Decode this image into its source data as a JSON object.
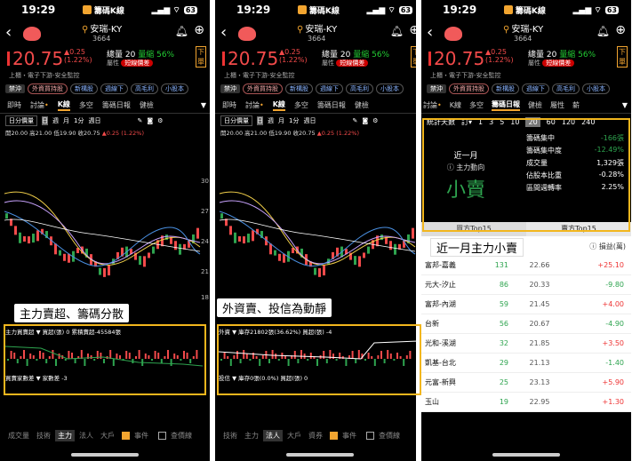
{
  "status": {
    "time1": "19:29",
    "time2": "19:29",
    "time3": "19:29",
    "app": "籌碼K線",
    "battery": "63"
  },
  "stock": {
    "name": "安瑞-KY",
    "code": "3664",
    "price": "20.75",
    "change": "▲0.25",
    "pct": "(1.22%)",
    "vol_label": "總量",
    "vol": "20",
    "amount_label": "量縮",
    "amount_pct": "56%",
    "attr_label": "屬性",
    "attr_badge": "短線價差",
    "trade": "下單",
    "industry": "上櫃・電子下游-安全監控"
  },
  "tags": [
    "禁沖",
    "外資買持股",
    "新構股",
    "週線下",
    "高毛利",
    "小股本"
  ],
  "tabs": [
    "即時",
    "討論",
    "K線",
    "多空",
    "籌碼日報",
    "健檢"
  ],
  "ctl": [
    "日分價量",
    "日",
    "週",
    "月",
    "1分",
    "週日"
  ],
  "ohlc": {
    "text": "開20.00 高21.00 低19.90 收20.75",
    "chg": "▲0.25 (1.22%)"
  },
  "axis": [
    "30",
    "27",
    "24",
    "21",
    "18"
  ],
  "captions": {
    "p1": "主力賣超、籌碼分散",
    "p2": "外資賣、投信為動靜"
  },
  "sub1": {
    "a": "主力買賣超 ▼ 買超(張) 0 累積賣超-45584張",
    "b": "買賣家數差 ▼ 家數差 -3"
  },
  "sub2": {
    "a": "外資 ▼ 庫存21802張(36.62%) 買超(張) -4",
    "b": "投信 ▼ 庫存0張(0.0%) 買超(張) 0"
  },
  "bottom1": [
    "成交量",
    "技術",
    "主力",
    "法人",
    "大戶"
  ],
  "bottom2": [
    "技術",
    "主力",
    "法人",
    "大戶",
    "資券"
  ],
  "bottom_chk": [
    "事件",
    "查價線"
  ],
  "p3": {
    "tabs": [
      "討論",
      "K線",
      "多空",
      "籌碼日報",
      "健檢",
      "屬性",
      "薪"
    ],
    "days_label": "統計天數",
    "days_opt": "訂",
    "days": [
      "1",
      "3",
      "5",
      "10",
      "20",
      "60",
      "120",
      "240"
    ],
    "period": "近一月",
    "flow": "主力動向",
    "verdict": "小賣",
    "metrics": [
      {
        "k": "籌碼集中",
        "v": "-166張"
      },
      {
        "k": "籌碼集中度",
        "v": "-12.49%"
      },
      {
        "k": "成交量",
        "v": "1,329張"
      },
      {
        "k": "佔股本比重",
        "v": "-0.28%"
      },
      {
        "k": "區間週轉率",
        "v": "2.25%"
      }
    ],
    "top15": [
      "買方Top15",
      "賣方Top15"
    ],
    "list_title": "近一月主力小賣",
    "list_hdr": "損益(萬)",
    "rows": [
      {
        "name": "富邦-嘉義",
        "c": "131",
        "p": "22.66",
        "v": "+25.10",
        "s": "r"
      },
      {
        "name": "元大-汐止",
        "c": "86",
        "p": "20.33",
        "v": "-9.80",
        "s": "g"
      },
      {
        "name": "富邦-內湖",
        "c": "59",
        "p": "21.45",
        "v": "+4.00",
        "s": "r"
      },
      {
        "name": "台新",
        "c": "56",
        "p": "20.67",
        "v": "-4.90",
        "s": "g"
      },
      {
        "name": "光和-溪湖",
        "c": "32",
        "p": "21.85",
        "v": "+3.50",
        "s": "r"
      },
      {
        "name": "凱基-台北",
        "c": "29",
        "p": "21.13",
        "v": "-1.40",
        "s": "g"
      },
      {
        "name": "元富-新興",
        "c": "25",
        "p": "23.13",
        "v": "+5.90",
        "s": "r"
      },
      {
        "name": "玉山",
        "c": "19",
        "p": "22.95",
        "v": "+1.30",
        "s": "r"
      }
    ]
  }
}
